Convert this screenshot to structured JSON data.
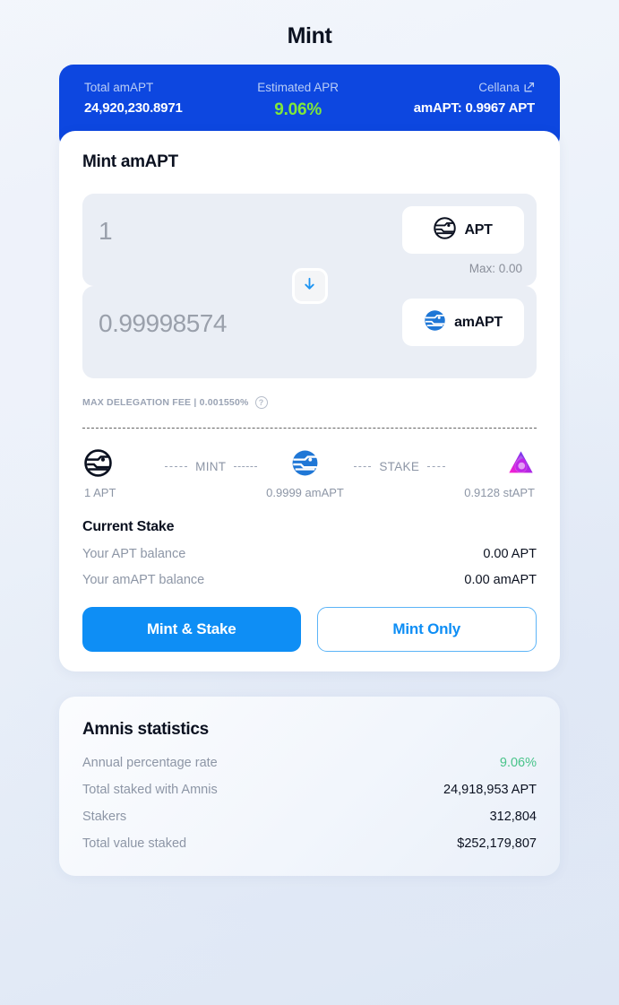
{
  "page": {
    "title": "Mint"
  },
  "banner": {
    "total_label": "Total amAPT",
    "total_value": "24,920,230.8971",
    "apr_label": "Estimated APR",
    "apr_value": "9.06%",
    "source_label": "Cellana",
    "source_icon": "external-link-icon",
    "rate_value": "amAPT: 0.9967 APT"
  },
  "mint": {
    "title": "Mint amAPT",
    "input": {
      "value": "",
      "placeholder": "1",
      "token": "APT",
      "token_icon": "aptos-logo-icon",
      "max_label": "Max: 0.00"
    },
    "output": {
      "value": "",
      "placeholder": "0.99998574",
      "token": "amAPT",
      "token_icon": "amapt-logo-icon"
    },
    "swap_icon": "arrow-down-icon",
    "fee_label": "MAX DELEGATION FEE | 0.001550%",
    "fee_help_icon": "question-mark-icon",
    "flow": {
      "steps": [
        {
          "icon": "aptos-logo-icon",
          "label": "1 APT"
        },
        {
          "icon": "amapt-logo-icon",
          "label": "0.9999 amAPT"
        },
        {
          "icon": "stapt-logo-icon",
          "label": "0.9128 stAPT"
        }
      ],
      "actions": [
        "MINT",
        "STAKE"
      ]
    },
    "stake": {
      "title": "Current Stake",
      "rows": [
        {
          "key": "Your APT balance",
          "value": "0.00 APT"
        },
        {
          "key": "Your amAPT balance",
          "value": "0.00 amAPT"
        }
      ]
    },
    "buttons": {
      "primary": "Mint & Stake",
      "secondary": "Mint Only"
    }
  },
  "stats": {
    "title": "Amnis statistics",
    "rows": [
      {
        "key": "Annual percentage rate",
        "value": "9.06%",
        "accent": true
      },
      {
        "key": "Total staked with Amnis",
        "value": "24,918,953 APT",
        "accent": false
      },
      {
        "key": "Stakers",
        "value": "312,804",
        "accent": false
      },
      {
        "key": "Total value staked",
        "value": "$252,179,807",
        "accent": false
      }
    ]
  },
  "colors": {
    "banner_blue": "#0d47e0",
    "apr_green": "#80e83a",
    "primary_blue": "#0e8ef5",
    "stat_green": "#49c48a"
  }
}
